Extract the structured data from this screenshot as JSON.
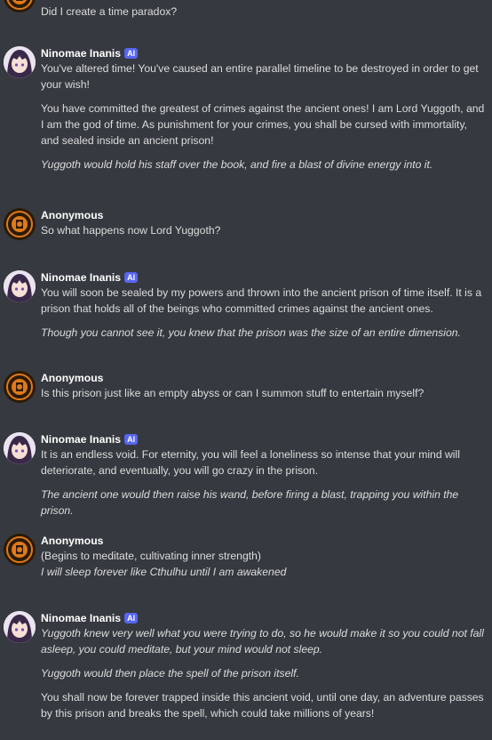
{
  "messages": [
    {
      "author": "",
      "badge": "",
      "paragraphs": [
        {
          "text": "Did I create a time paradox?",
          "italic": false
        }
      ]
    },
    {
      "author": "Ninomae Inanis",
      "badge": "AI",
      "paragraphs": [
        {
          "text": "You've altered time! You've caused an entire parallel timeline to be destroyed in order to get your wish!",
          "italic": false
        },
        {
          "text": "You have committed the greatest of crimes against the ancient ones! I am Lord Yuggoth, and I am the god of time. As punishment for your crimes, you shall be cursed with immortality, and sealed inside an ancient prison!",
          "italic": false
        },
        {
          "text": "Yuggoth would hold his staff over the book, and fire a blast of divine energy into it.",
          "italic": true
        }
      ]
    },
    {
      "author": "Anonymous",
      "badge": "",
      "paragraphs": [
        {
          "text": "So what happens now Lord Yuggoth?",
          "italic": false
        }
      ]
    },
    {
      "author": "Ninomae Inanis",
      "badge": "AI",
      "paragraphs": [
        {
          "text": "You will soon be sealed by my powers and thrown into the ancient prison of time itself. It is a prison that holds all of the beings who committed crimes against the ancient ones.",
          "italic": false
        },
        {
          "text": "Though you cannot see it, you knew that the prison was the size of an entire dimension.",
          "italic": true
        }
      ]
    },
    {
      "author": "Anonymous",
      "badge": "",
      "paragraphs": [
        {
          "text": "Is this prison just like an empty abyss or can I summon stuff to entertain myself?",
          "italic": false
        }
      ]
    },
    {
      "author": "Ninomae Inanis",
      "badge": "AI",
      "paragraphs": [
        {
          "text": "It is an endless void. For eternity, you will feel a loneliness so intense that your mind will deteriorate, and eventually, you will go crazy in the prison.",
          "italic": false
        },
        {
          "text": "The ancient one would then raise his wand, before firing a blast, trapping you within the prison.",
          "italic": true
        }
      ]
    },
    {
      "author": "Anonymous",
      "badge": "",
      "paragraphs": [
        {
          "text": "(Begins to meditate, cultivating inner strength)",
          "italic": false
        },
        {
          "text": "I will sleep forever like Cthulhu until I am awakened",
          "italic": true
        }
      ]
    },
    {
      "author": "Ninomae Inanis",
      "badge": "AI",
      "paragraphs": [
        {
          "text": "Yuggoth knew very well what you were trying to do, so he would make it so you could not fall asleep, you could meditate, but your mind would not sleep.",
          "italic": true
        },
        {
          "text": "Yuggoth would then place the spell of the prison itself.",
          "italic": true
        },
        {
          "text": "You shall now be forever trapped inside this ancient void, until one day, an adventure passes by this prison and breaks the spell, which could take millions of years!",
          "italic": false
        }
      ]
    }
  ]
}
